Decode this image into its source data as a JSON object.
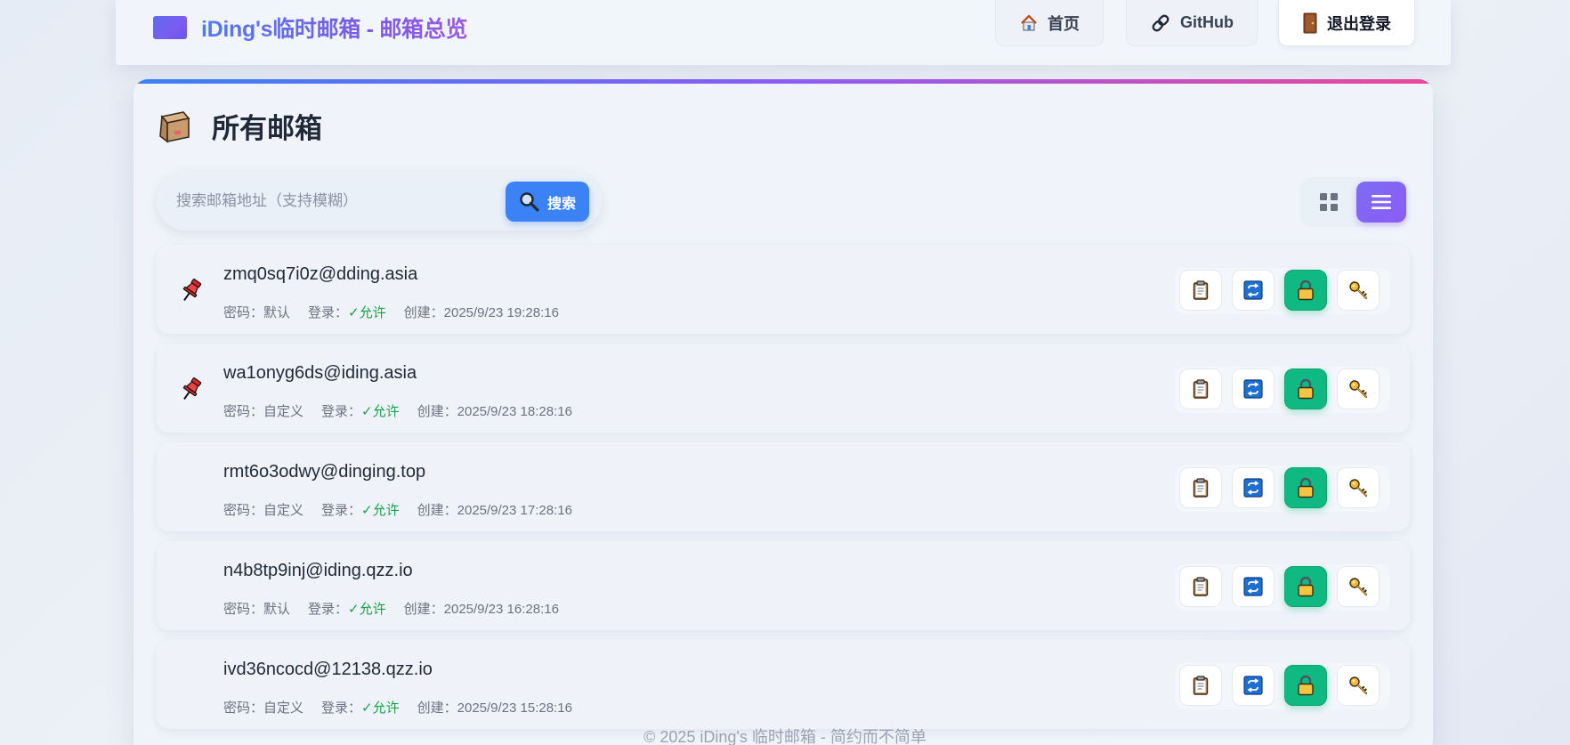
{
  "header": {
    "title": "iDing's临时邮箱 - 邮箱总览",
    "nav": {
      "home_label": "首页",
      "github_label": "GitHub",
      "logout_label": "退出登录"
    }
  },
  "panel": {
    "title": "所有邮箱",
    "search": {
      "placeholder": "搜索邮箱地址（支持模糊）",
      "value": "",
      "button_label": "搜索"
    },
    "view_mode": "list"
  },
  "mailboxes": [
    {
      "address": "zmq0sq7i0z@dding.asia",
      "password_label": "密码：",
      "password": "默认",
      "login_label": "登录：",
      "login": "✓允许",
      "created_label": "创建：",
      "created": "2025/9/23 19:28:16",
      "pinned": true
    },
    {
      "address": "wa1onyg6ds@iding.asia",
      "password_label": "密码：",
      "password": "自定义",
      "login_label": "登录：",
      "login": "✓允许",
      "created_label": "创建：",
      "created": "2025/9/23 18:28:16",
      "pinned": true
    },
    {
      "address": "rmt6o3odwy@dinging.top",
      "password_label": "密码：",
      "password": "自定义",
      "login_label": "登录：",
      "login": "✓允许",
      "created_label": "创建：",
      "created": "2025/9/23 17:28:16",
      "pinned": false
    },
    {
      "address": "n4b8tp9inj@iding.qzz.io",
      "password_label": "密码：",
      "password": "默认",
      "login_label": "登录：",
      "login": "✓允许",
      "created_label": "创建：",
      "created": "2025/9/23 16:28:16",
      "pinned": false
    },
    {
      "address": "ivd36ncocd@12138.qzz.io",
      "password_label": "密码：",
      "password": "自定义",
      "login_label": "登录：",
      "login": "✓允许",
      "created_label": "创建：",
      "created": "2025/9/23 15:28:16",
      "pinned": false
    }
  ],
  "icons": {
    "pin": "pushpin-icon",
    "copy": "clipboard-icon",
    "switch": "repeat-icon",
    "lock": "lock-icon",
    "password": "key-icon"
  },
  "colors": {
    "accent_blue": "#3b82f6",
    "accent_purple": "#8b5cf6",
    "accent_pink": "#ec4899",
    "success": "#16a34a",
    "lock_button": "#10b981"
  },
  "footer": {
    "text": "© 2025 iDing's 临时邮箱 - 简约而不简单"
  }
}
